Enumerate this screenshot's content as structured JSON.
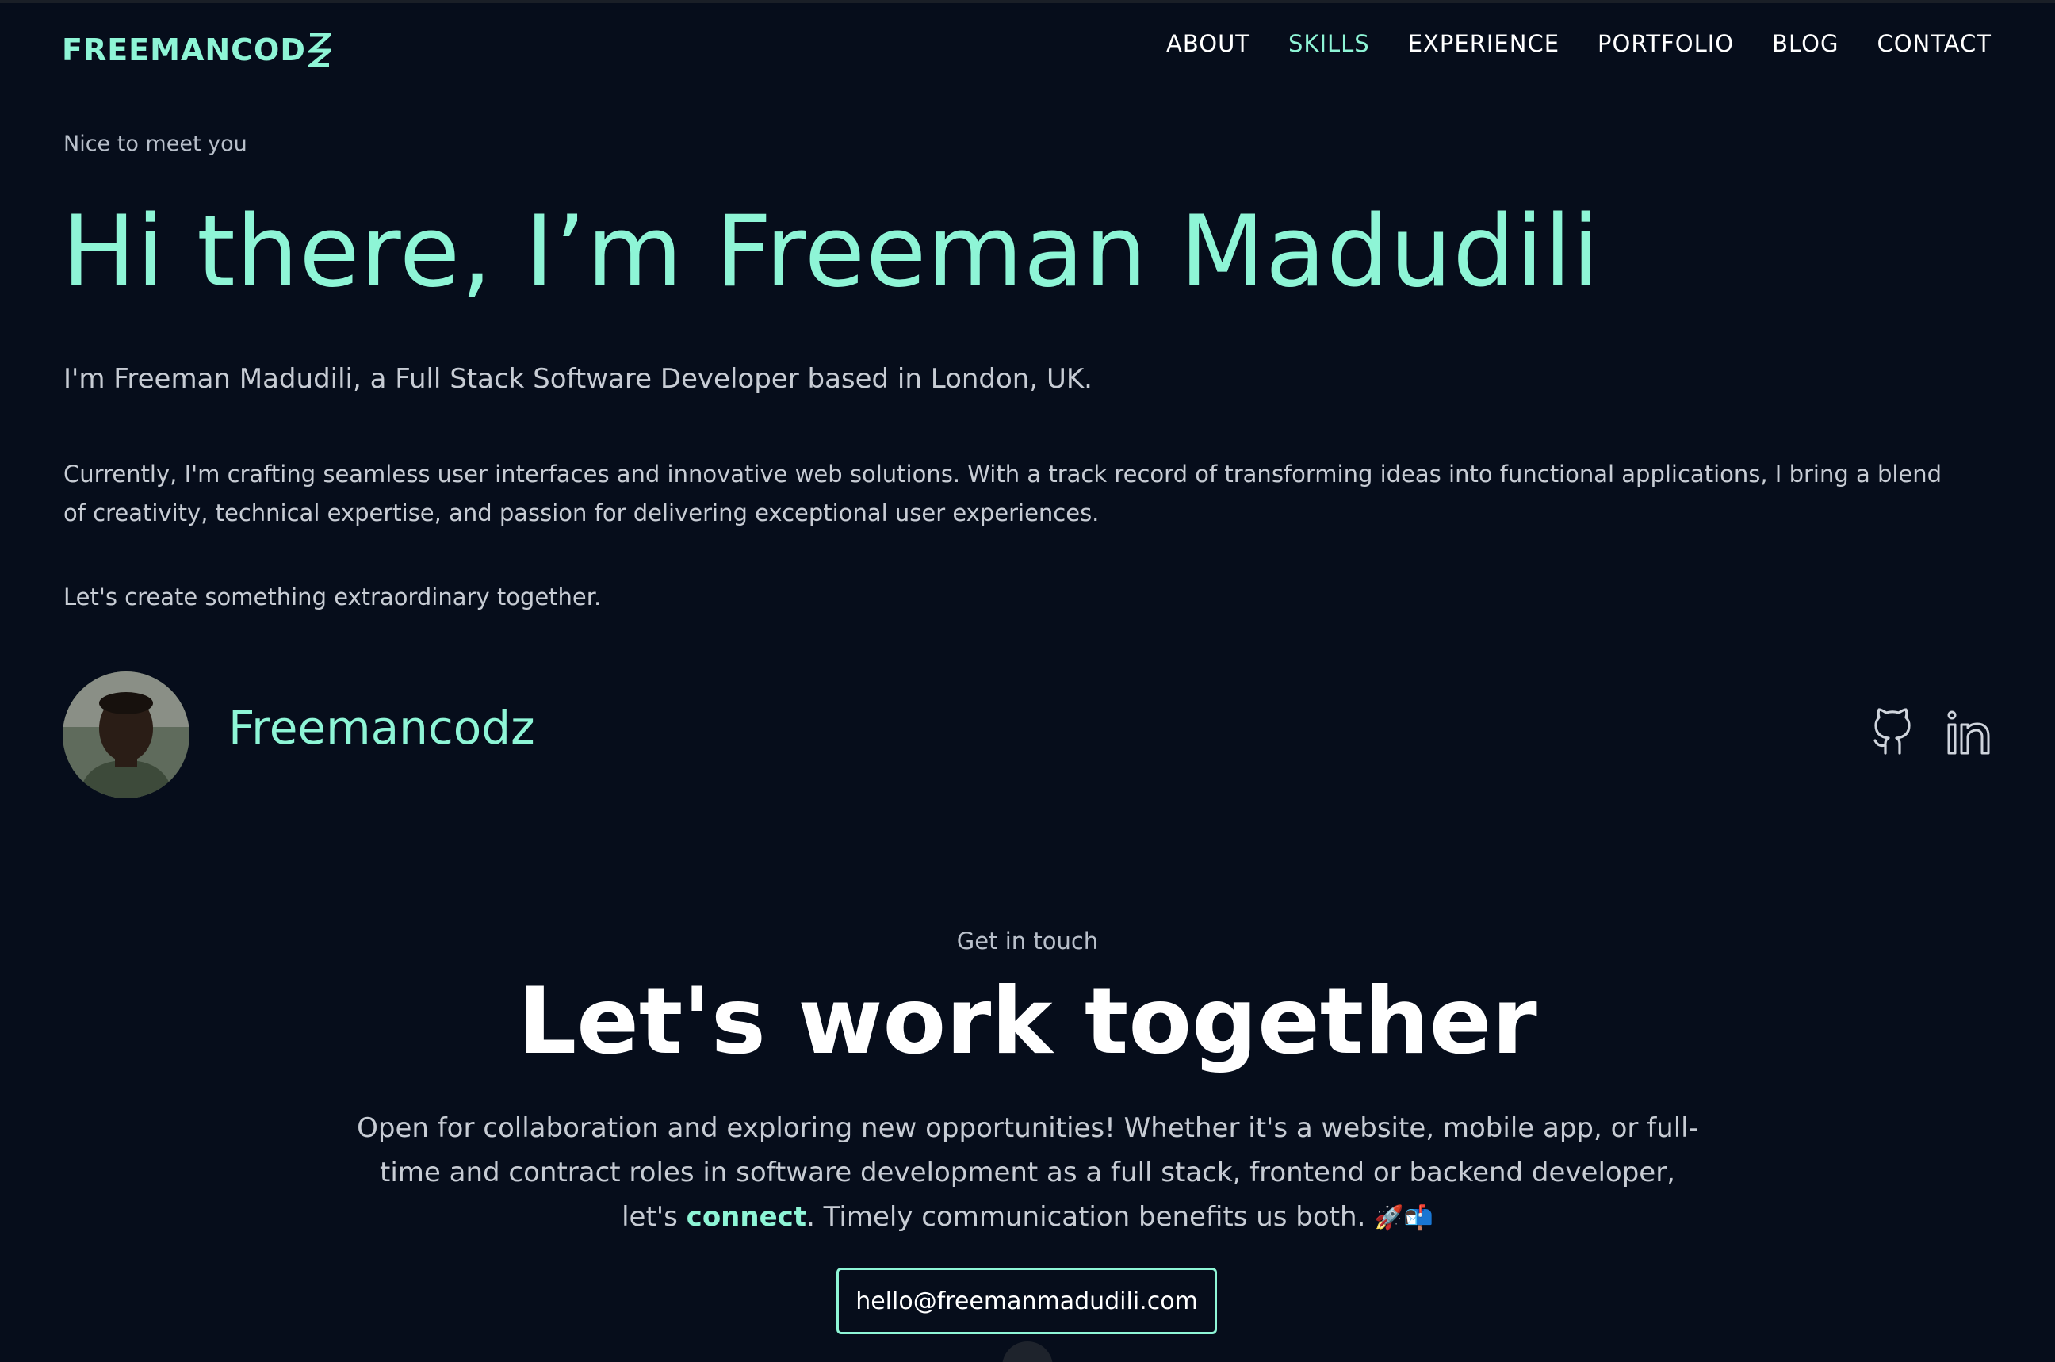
{
  "header": {
    "logo": "FREEMANCOD",
    "nav": [
      {
        "label": "ABOUT",
        "active": false
      },
      {
        "label": "SKILLS",
        "active": true
      },
      {
        "label": "EXPERIENCE",
        "active": false
      },
      {
        "label": "PORTFOLIO",
        "active": false
      },
      {
        "label": "BLOG",
        "active": false
      },
      {
        "label": "CONTACT",
        "active": false
      }
    ]
  },
  "hero": {
    "eyebrow": "Nice to meet you",
    "title": "Hi there, I’m Freeman Madudili",
    "intro": "I'm Freeman Madudili, a Full Stack Software Developer based in London, UK.",
    "description": "Currently, I'm crafting seamless user interfaces and innovative web solutions. With a track record of transforming ideas into functional applications, I bring a blend of creativity, technical expertise, and passion for delivering exceptional user experiences.",
    "cta": "Let's create something extraordinary together."
  },
  "profile": {
    "name": "Freemancodz",
    "socials": [
      {
        "icon": "github-icon"
      },
      {
        "icon": "linkedin-icon"
      }
    ]
  },
  "contact": {
    "eyebrow": "Get in touch",
    "title": "Let's work together",
    "body_before": "Open for collaboration and exploring new opportunities! Whether it's a website, mobile app, or full-time and contract roles in software development as a full stack, frontend or backend developer, let's ",
    "link": "connect",
    "body_after": ". Timely communication benefits us both. ",
    "emoji": "🚀📬",
    "email": "hello@freemanmadudili.com"
  },
  "colors": {
    "background": "#060d1b",
    "accent": "#8ef5d6",
    "text": "#c7ccd4"
  }
}
